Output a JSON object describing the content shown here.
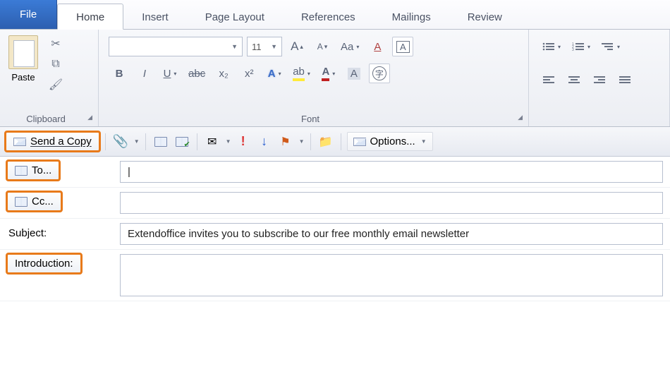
{
  "tabs": {
    "file": "File",
    "home": "Home",
    "insert": "Insert",
    "page_layout": "Page Layout",
    "references": "References",
    "mailings": "Mailings",
    "review": "Review"
  },
  "ribbon": {
    "clipboard": {
      "label": "Clipboard",
      "paste": "Paste"
    },
    "font": {
      "label": "Font",
      "size": "11",
      "grow": "A",
      "shrink": "A",
      "case": "Aa",
      "clear": "A",
      "bold": "B",
      "italic": "I",
      "underline": "U",
      "strike": "abc",
      "sub": "x₂",
      "sup": "x²",
      "textfx": "A",
      "highlight": "ab",
      "fontcolor": "A",
      "enclose": "字"
    }
  },
  "mail_toolbar": {
    "send": "Send a Copy",
    "options": "Options..."
  },
  "compose": {
    "to_label": "To...",
    "cc_label": "Cc...",
    "subject_label": "Subject:",
    "intro_label": "Introduction:",
    "to_value": "",
    "cc_value": "",
    "subject_value": "Extendoffice invites you to subscribe to our free monthly email newsletter",
    "intro_value": ""
  }
}
